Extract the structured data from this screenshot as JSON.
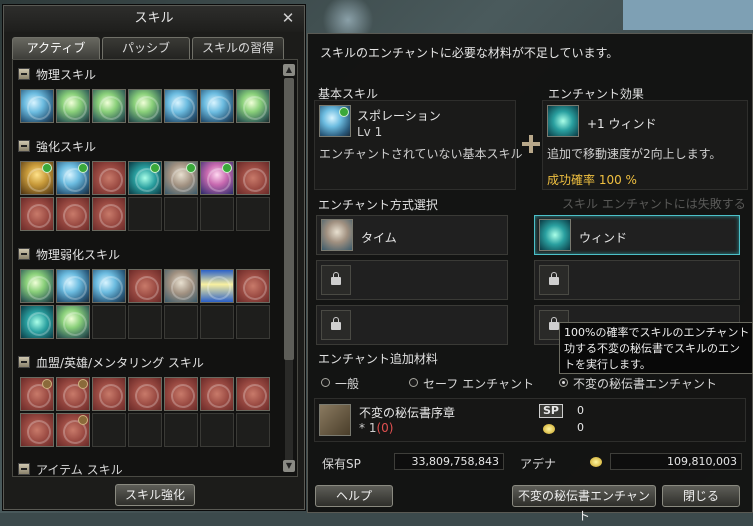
{
  "skill_window": {
    "title": "スキル",
    "tabs": [
      "アクティブ",
      "パッシブ",
      "スキルの習得"
    ],
    "categories": [
      {
        "title": "物理スキル"
      },
      {
        "title": "強化スキル"
      },
      {
        "title": "物理弱化スキル"
      },
      {
        "title": "血盟/英雄/メンタリング スキル"
      }
    ],
    "more_category": "アイテム スキル",
    "enhance_button": "スキル強化"
  },
  "enchant_window": {
    "message": "スキルのエンチャントに必要な材料が不足しています。",
    "base_skill": {
      "label": "基本スキル",
      "name": "スポレーション",
      "level": "Lv 1",
      "desc": "エンチャントされていない基本スキル"
    },
    "effect": {
      "label": "エンチャント効果",
      "name": "+1 ウィンド",
      "desc": "追加で移動速度が2向上します。",
      "rate": "成功確率 100 %"
    },
    "bg_ghost_text": "スキル エンチャントには失敗する",
    "method": {
      "label": "エンチャント方式選択",
      "options": [
        {
          "name": "タイム"
        },
        {
          "name": "ウィンド"
        }
      ]
    },
    "materials": {
      "label": "エンチャント追加材料",
      "radios": [
        "一般",
        "セーフ エンチャント",
        "不変の秘伝書エンチャント"
      ],
      "selected": 2,
      "item_name": "不変の秘伝書序章",
      "item_count_prefix": "* 1",
      "item_count_paren": "(0)",
      "sp_value": "0",
      "adena_value": "0"
    },
    "held_sp_label": "保有SP",
    "held_sp": "33,809,758,843",
    "adena_label": "アデナ",
    "adena": "109,810,003",
    "buttons": {
      "help": "ヘルプ",
      "immutable": "不変の秘伝書エンチャント",
      "close": "閉じる"
    }
  },
  "tooltip": {
    "lines": [
      "100%の確率でスキルのエンチャント",
      "功する不変の秘伝書でスキルのエン",
      "トを実行します。"
    ]
  },
  "colors": {
    "selected_border": "#4cc0c8",
    "success_rate": "#f0c040",
    "window_bg": "#121211"
  }
}
